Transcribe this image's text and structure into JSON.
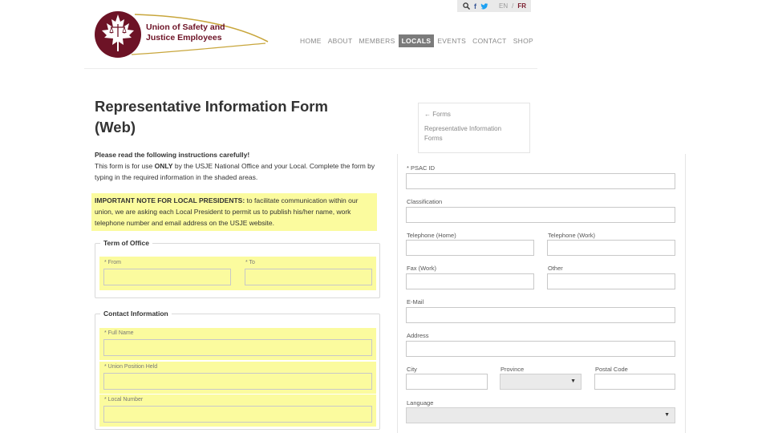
{
  "topbar": {
    "lang_en": "EN",
    "lang_sep": "/",
    "lang_fr": "FR"
  },
  "brand": {
    "line1": "Union of Safety and",
    "line2": "Justice Employees",
    "colors": {
      "maroon": "#6d1326",
      "gold": "#c8a63c"
    }
  },
  "nav": {
    "items": [
      "HOME",
      "ABOUT",
      "MEMBERS",
      "LOCALS",
      "EVENTS",
      "CONTACT",
      "SHOP"
    ],
    "active": "LOCALS"
  },
  "page": {
    "title_line1": "Representative Information Form",
    "title_line2": "(Web)",
    "instructions_head": "Please read the following instructions carefully!",
    "instructions_a": "This form is for use ",
    "instructions_only": "ONLY",
    "instructions_b": " by the USJE National Office and your Local. Complete the form by typing in the required information in the shaded areas.",
    "note_head": "IMPORTANT NOTE FOR LOCAL PRESIDENTS:",
    "note_body": " to facilitate communication within our union, we are asking each Local President to permit us to publish his/her name, work telephone number and email address on the USJE website."
  },
  "term": {
    "legend": "Term of Office",
    "from_label": "* From",
    "to_label": "* To"
  },
  "contact": {
    "legend": "Contact Information",
    "full_name_label": "* Full Name",
    "position_label": "* Union Position Held",
    "local_label": "* Local Number"
  },
  "sidenav": {
    "back": "← Forms",
    "current_line1": "Representative Information",
    "current_line2": "Forms"
  },
  "right_form": {
    "psac_id": "* PSAC ID",
    "classification": "Classification",
    "tel_home": "Telephone (Home)",
    "tel_work": "Telephone (Work)",
    "fax": "Fax (Work)",
    "other": "Other",
    "email": "E-Mail",
    "address": "Address",
    "city": "City",
    "province": "Province",
    "postal": "Postal Code",
    "language": "Language"
  },
  "colors": {
    "highlight": "#fbfb9e",
    "nav_active": "#7b7b7b"
  }
}
